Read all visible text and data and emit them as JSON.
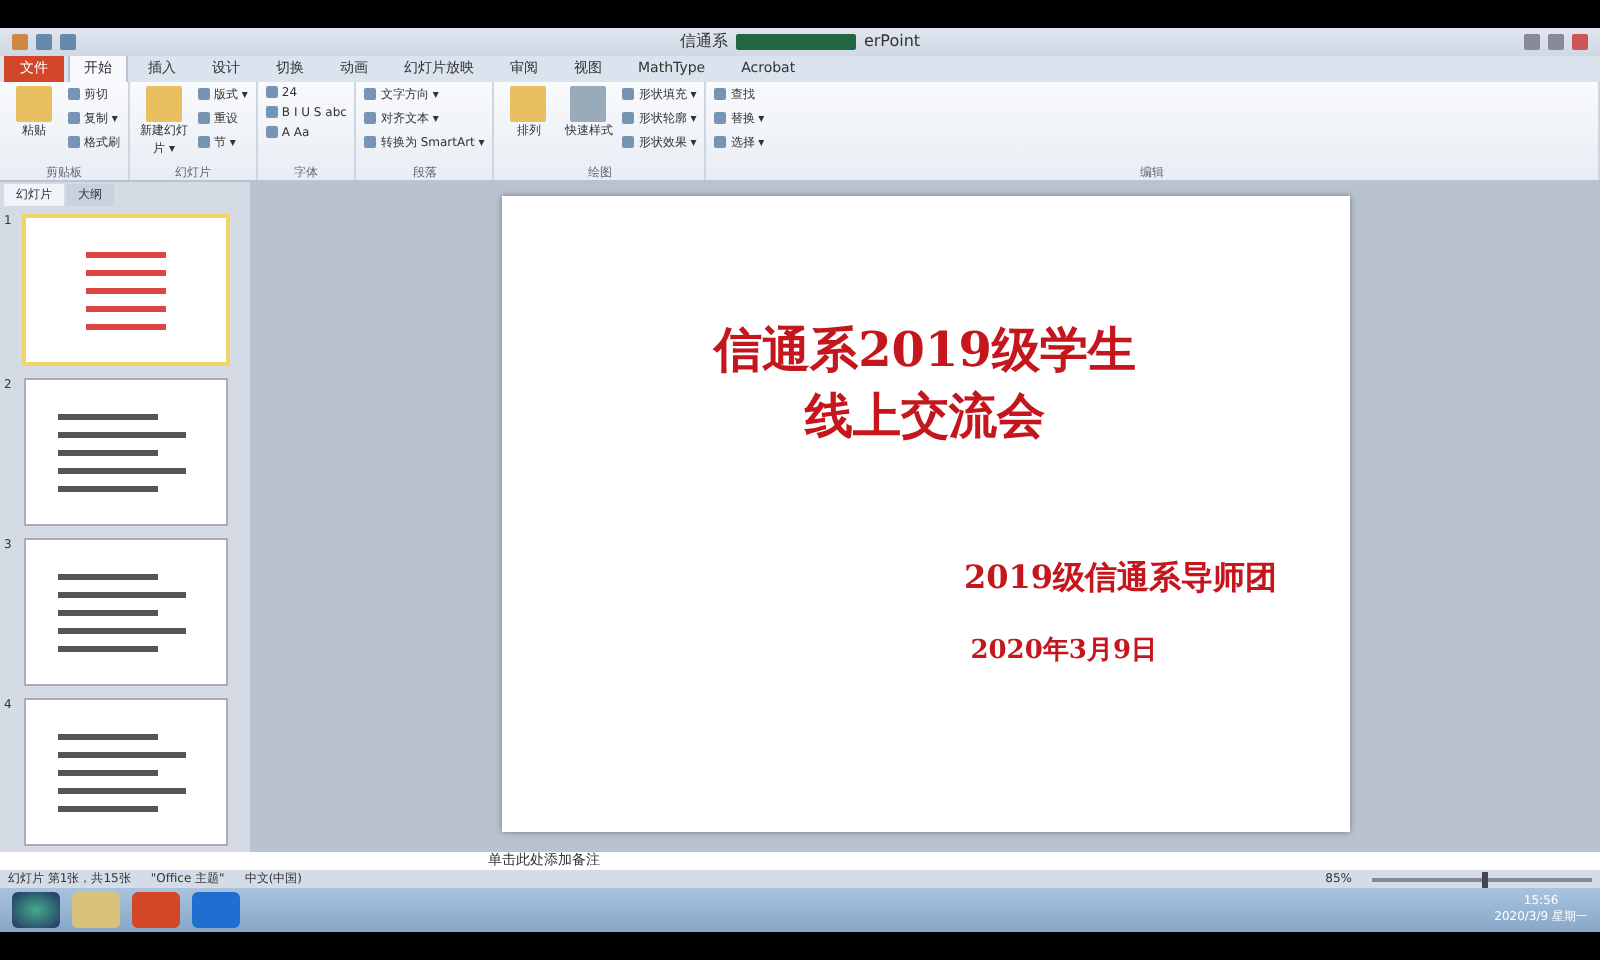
{
  "window": {
    "title_start": "信通系",
    "title_end": "erPoint"
  },
  "tabs": [
    {
      "label": "文件",
      "kind": "file",
      "selected": false
    },
    {
      "label": "开始",
      "kind": "tab",
      "selected": true
    },
    {
      "label": "插入",
      "kind": "tab",
      "selected": false
    },
    {
      "label": "设计",
      "kind": "tab",
      "selected": false
    },
    {
      "label": "切换",
      "kind": "tab",
      "selected": false
    },
    {
      "label": "动画",
      "kind": "tab",
      "selected": false
    },
    {
      "label": "幻灯片放映",
      "kind": "tab",
      "selected": false
    },
    {
      "label": "审阅",
      "kind": "tab",
      "selected": false
    },
    {
      "label": "视图",
      "kind": "tab",
      "selected": false
    },
    {
      "label": "MathType",
      "kind": "tab",
      "selected": false
    },
    {
      "label": "Acrobat",
      "kind": "tab",
      "selected": false
    }
  ],
  "ribbon": [
    {
      "name": "剪贴板",
      "big": [
        "粘贴"
      ],
      "small": [
        "剪切",
        "复制 ▾",
        "格式刷"
      ]
    },
    {
      "name": "幻灯片",
      "big": [
        "新建幻灯片 ▾"
      ],
      "small": [
        "版式 ▾",
        "重设",
        "节 ▾"
      ]
    },
    {
      "name": "字体",
      "small": [
        "24",
        "B  I  U  S  abc",
        "A  Aa"
      ]
    },
    {
      "name": "段落",
      "small": [
        "文字方向 ▾",
        "对齐文本 ▾",
        "转换为 SmartArt ▾"
      ]
    },
    {
      "name": "绘图",
      "big": [
        "排列",
        "快速样式"
      ],
      "small": [
        "形状填充 ▾",
        "形状轮廓 ▾",
        "形状效果 ▾"
      ]
    },
    {
      "name": "编辑",
      "small": [
        "查找",
        "替换 ▾",
        "选择 ▾"
      ]
    }
  ],
  "pane_tabs": [
    {
      "label": "幻灯片",
      "selected": true
    },
    {
      "label": "大纲",
      "selected": false
    }
  ],
  "thumbnails": [
    {
      "number": "1",
      "selected": true
    },
    {
      "number": "2",
      "selected": false
    },
    {
      "number": "3",
      "selected": false
    },
    {
      "number": "4",
      "selected": false
    }
  ],
  "slide": {
    "title_lines": [
      "信通系2019级学生",
      "线上交流会"
    ],
    "subtitle": "2019级信通系导师团",
    "date": "2020年3月9日"
  },
  "notes": {
    "placeholder": "单击此处添加备注"
  },
  "status_bar": {
    "slide_info": "幻灯片 第1张，共15张",
    "theme": "\"Office 主题\"",
    "language": "中文(中国)",
    "zoom": "85%",
    "level": 0.5
  },
  "taskbar": {
    "time": "15:56",
    "date": "2020/3/9 星期一"
  }
}
